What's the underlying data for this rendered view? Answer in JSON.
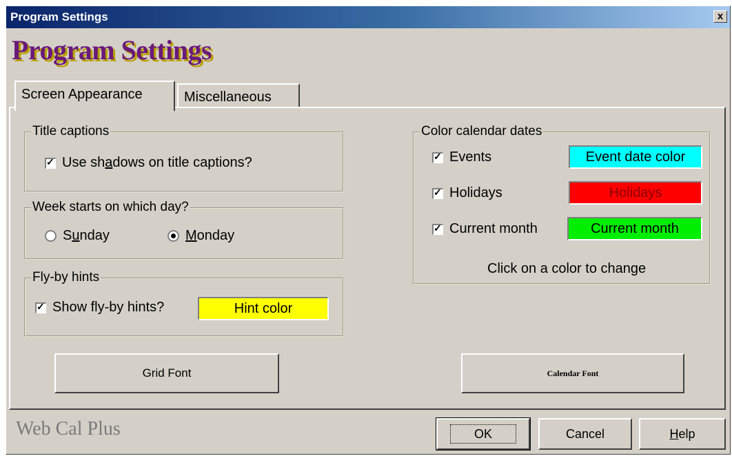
{
  "window": {
    "title": "Program Settings",
    "close_label": "x"
  },
  "banner": {
    "text": "Program Settings"
  },
  "tabs": [
    {
      "label": "Screen Appearance",
      "active": true
    },
    {
      "label": "Miscellaneous",
      "active": false
    }
  ],
  "title_captions": {
    "legend": "Title captions",
    "shadows_label_pre": "Use sh",
    "shadows_label_mid": "a",
    "shadows_label_post": "dows on title captions?",
    "shadows_checked": true
  },
  "week_start": {
    "legend": "Week starts on which day?",
    "sunday_pre": "S",
    "sunday_mid": "u",
    "sunday_post": "nday",
    "monday_mid": "M",
    "monday_post": "onday",
    "selected": "Monday"
  },
  "flyby": {
    "legend": "Fly-by hints",
    "show_label": "Show fly-by hints?",
    "show_checked": true,
    "hint_color_label": "Hint color",
    "hint_color": "#ffff00"
  },
  "color_dates": {
    "legend": "Color calendar dates",
    "items": [
      {
        "label": "Events",
        "checked": true,
        "button": "Event date color",
        "color": "#00ffff"
      },
      {
        "label": "Holidays",
        "checked": true,
        "button": "Holidays",
        "color": "#ff0000"
      },
      {
        "label": "Current month",
        "checked": true,
        "button": "Current month",
        "color": "#00ff00"
      }
    ],
    "note": "Click on a color to change"
  },
  "buttons": {
    "grid_font": "Grid Font",
    "calendar_font": "Calendar Font",
    "ok": "OK",
    "cancel": "Cancel",
    "help_mid": "H",
    "help_post": "elp"
  },
  "footer": {
    "brand": "Web Cal Plus"
  }
}
